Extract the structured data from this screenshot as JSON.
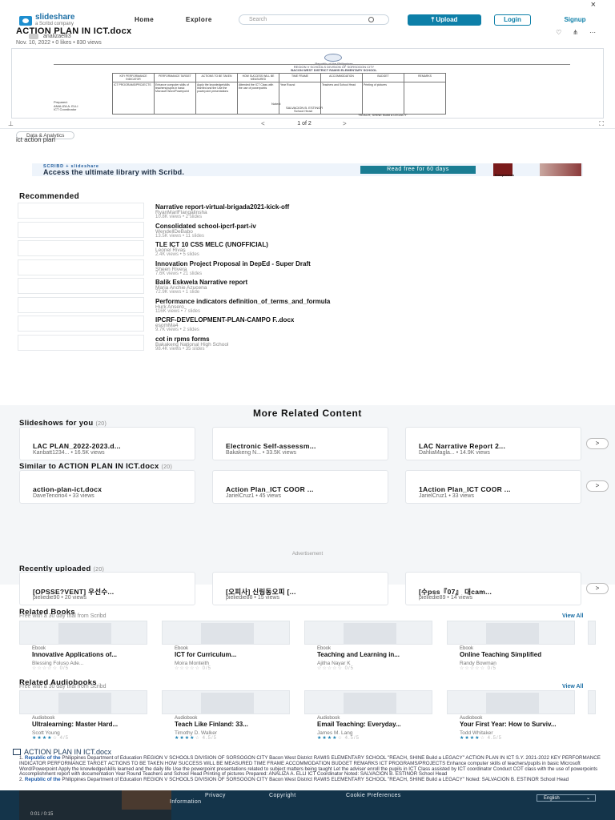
{
  "close_icon": "×",
  "header": {
    "brand_name": "slideshare",
    "brand_tagline": "a Scribd company",
    "nav_home": "Home",
    "nav_explore": "Explore",
    "search_placeholder": "Search",
    "upload_label": "Upload",
    "login_label": "Login",
    "signup_label": "Signup"
  },
  "document": {
    "title": "ACTION PLAN IN ICT.docx",
    "author": "analizaelli3",
    "meta": "Nov. 10, 2022 • 0 likes • 830 views",
    "page_indicator": "1 of 2",
    "category_tag": "Data & Analytics",
    "description": "ict action plan"
  },
  "preview": {
    "line1": "Republic of the Philippines",
    "line2": "Department of Education",
    "line3": "REGION V SCHOOLS DIVISION OF SORSOGON CITY",
    "line4": "BACON WEST DISTRICT RAWIS ELEMENTARY SCHOOL",
    "line5": "ACTION PLAN IN ICT",
    "line6": "S.Y. 2021-2022",
    "columns": [
      "KEY PERFORMANCE INDICATOR",
      "PERFORMANCE TARGET",
      "ACTIONS TO BE TAKEN",
      "HOW SUCCESS WILL BE MEASURED",
      "TIME FRAME",
      "ACCOMMODATION",
      "BUDGET",
      "REMARKS"
    ],
    "cells": [
      "ICT PROGRAMS/PROJECTS",
      "Enhance computer skills of teachers/pupils in basic Microsoft Word/Powerpoint",
      "Apply the knowledge/skills learned and the Use the powerpoint presentations",
      "Attended the ICT Class with the use of powerpoints",
      "Year Round",
      "Teachers and School Head",
      "Printing of pictures",
      ""
    ],
    "prepared": "Prepared:",
    "prepared_name": "ANALIZA A. ELLI",
    "prepared_role": "ICT Coordinator",
    "noted": "Noted:",
    "noted_name": "SALVACION B. ESTINOR",
    "noted_role": "School Head",
    "motto": "\"REACH, SHINE Build a LEGACY\""
  },
  "banner": {
    "brand": "SCRIBD + slideshare",
    "message": "Access the ultimate library with Scribd.",
    "cta": "Read free for 60 days",
    "ad_book_label": "Entrepreneurs"
  },
  "recommended": {
    "heading": "Recommended",
    "items": [
      {
        "title": "Narrative report-virtual-brigada2021-kick-off",
        "author": "RyanMarlFlangalinsha",
        "stats": "10.8K views • 2 slides"
      },
      {
        "title": "Consolidated school-ipcrf-part-iv",
        "author": "WendellDeBabo",
        "stats": "13.5K views • 11 slides"
      },
      {
        "title": "TLE ICT 10 CSS MELC (UNOFFICIAL)",
        "author": "Leonel Rivas",
        "stats": "2.4K views • 5 slides"
      },
      {
        "title": "Innovation Project Proposal in DepEd - Super Draft",
        "author": "Sheen Rivera",
        "stats": "7.6K views • 21 slides"
      },
      {
        "title": "Balik Eskwela Narrative report",
        "author": "Maria Anchie Azucena",
        "stats": "72.9K views • 1 slide"
      },
      {
        "title": "Performance indicators definition_of_terms_and_formula",
        "author": "Hurk Ansero",
        "stats": "116K views • 7 slides"
      },
      {
        "title": "IPCRF-DEVELOPMENT-PLAN-CAMPO F..docx",
        "author": "esomMa4",
        "stats": "9.7K views • 2 slides"
      },
      {
        "title": "cot in rpms forms",
        "author": "Bakakeng National High School",
        "stats": "98.4K views • 35 slides"
      }
    ]
  },
  "more_related": {
    "heading": "More Related Content",
    "slideshows": {
      "heading": "Slideshows for you",
      "count": "(20)",
      "cards": [
        {
          "title": "LAC PLAN_2022-2023.d...",
          "sub": "Kanbatt1234...  •  16.5K views"
        },
        {
          "title": "Electronic Self-assessm...",
          "sub": "Bakakeng N...  •  33.5K views"
        },
        {
          "title": "LAC Narrative Report 2...",
          "sub": "DahliaMagla...  •  14.9K views"
        }
      ]
    },
    "similar": {
      "heading": "Similar to ACTION PLAN IN ICT.docx",
      "count": "(20)",
      "cards": [
        {
          "title": "action-plan-ict.docx",
          "sub": "DaveTenorio4  •  33 views"
        },
        {
          "title": "Action Plan_ICT COOR ...",
          "sub": "JarielCruz1  •  45 views"
        },
        {
          "title": "1Action Plan_ICT COOR ...",
          "sub": "JarielCruz1  •  33 views"
        }
      ]
    },
    "ad_label": "Advertisement",
    "recent": {
      "heading": "Recently uploaded",
      "count": "(20)",
      "cards": [
        {
          "title": "[OPSSE?VENT] 우선수...",
          "sub": "pieliedie90  •  20 views"
        },
        {
          "title": "[오피사] 신림동오피 [...",
          "sub": "pieliedie88  •  15 views"
        },
        {
          "title": "[수pss『07』 대cam...",
          "sub": "pieliedie89  •  14 views"
        }
      ]
    },
    "next_arrow": ">"
  },
  "related_books": {
    "heading": "Related Books",
    "sub": "Free with a 30 day trial from Scribd",
    "view_all": "View All",
    "items": [
      {
        "kind": "Ebook",
        "title": "Innovative Applications of...",
        "author": "Blessing Foluso Ade...",
        "rating": "0/5",
        "filled": 0
      },
      {
        "kind": "Ebook",
        "title": "ICT for Curriculum...",
        "author": "Moira Monteith",
        "rating": "0/5",
        "filled": 0
      },
      {
        "kind": "Ebook",
        "title": "Teaching and Learning in...",
        "author": "Ajitha Nayar K",
        "rating": "0/5",
        "filled": 0
      },
      {
        "kind": "Ebook",
        "title": "Online Teaching Simplified",
        "author": "Randy Bowman",
        "rating": "0/5",
        "filled": 0
      }
    ]
  },
  "related_audiobooks": {
    "heading": "Related Audiobooks",
    "sub": "Free with a 30 day trial from Scribd",
    "view_all": "View All",
    "items": [
      {
        "kind": "Audiobook",
        "title": "Ultralearning: Master Hard...",
        "author": "Scott Young",
        "rating": "4/5",
        "filled": 4
      },
      {
        "kind": "Audiobook",
        "title": "Teach Like Finland: 33...",
        "author": "Timothy D. Walker",
        "rating": "4.5/5",
        "filled": 4
      },
      {
        "kind": "Audiobook",
        "title": "Email Teaching: Everyday...",
        "author": "James M. Lang",
        "rating": "4.5/5",
        "filled": 4
      },
      {
        "kind": "Audiobook",
        "title": "Your First Year: How to Surviv...",
        "author": "Todd Whitaker",
        "rating": "4.5/5",
        "filled": 4
      }
    ]
  },
  "transcript": {
    "heading": "ACTION PLAN IN ICT.docx",
    "p1_lead": "Republic of the",
    "p1_text": "Philippines Department of Education REGION V SCHOOLS DIVISION OF SORSOGON CITY Bacon West District RAWIS ELEMENTARY SCHOOL \"REACH, SHINE Build a LEGACY\" ACTION PLAN IN ICT S.Y. 2021-2022 KEY PERFORMANCE INDICATOR PERFORMANCE TARGET ACTIONS TO BE TAKEN HOW SUCCESS WILL BE MEASURED TIME FRAME ACCOMMODATION BUDGET REMARKS ICT PROGRAMS/PROJECTS Enhance computer skills of teachers/pupils in basic Microsoft Word/Powerpoint Apply the knowledge/skills learned and the daily life Use the powerpoint presentations related to subject matters being taught Let the adviser enroll the pupils in ICT Class assisted by ICT coordinator Conduct COT class with the use of powerpoints Accomplishment report with documentation Year Round Teachers and School Head Printing of pictures Prepared: ANALIZA A. ELLI ICT Coordinator Noted: SALVACION B. ESTINOR School Head",
    "p2_lead": "Republic of the",
    "p2_text": "Philippines Department of Education REGION V SCHOOLS DIVISION OF SORSOGON CITY Bacon West District RAWIS ELEMENTARY SCHOOL \"REACH, SHINE Build a LEGACY\" Noted: SALVACION B. ESTINOR School Head"
  },
  "footer": {
    "privacy": "Privacy",
    "copyright": "Copyright",
    "cookie": "Cookie Preferences",
    "information": "Information",
    "language": "English",
    "video_time": "0:01 / 0:15"
  }
}
